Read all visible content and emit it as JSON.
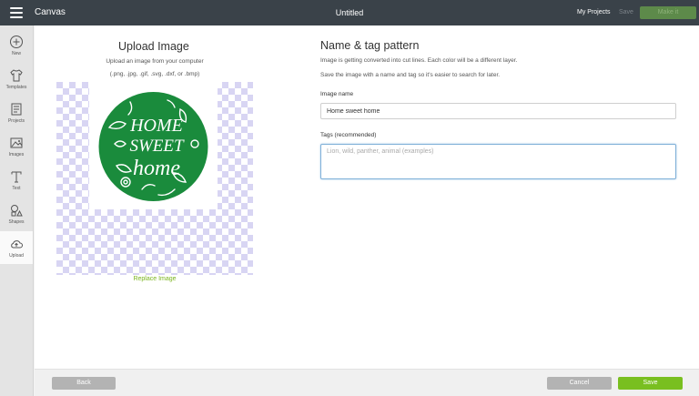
{
  "topbar": {
    "app_title": "Canvas",
    "doc_title": "Untitled",
    "my_projects": "My Projects",
    "save": "Save",
    "make_it": "Make it"
  },
  "sidebar": {
    "items": [
      {
        "label": "New",
        "icon": "plus-circle-icon"
      },
      {
        "label": "Templates",
        "icon": "tshirt-icon"
      },
      {
        "label": "Projects",
        "icon": "projects-icon"
      },
      {
        "label": "Images",
        "icon": "image-icon"
      },
      {
        "label": "Text",
        "icon": "text-icon"
      },
      {
        "label": "Shapes",
        "icon": "shapes-icon"
      },
      {
        "label": "Upload",
        "icon": "cloud-upload-icon",
        "active": true
      }
    ]
  },
  "upload": {
    "title": "Upload Image",
    "subtitle": "Upload an image from your computer",
    "file_types": "(.png, .jpg, .gif, .svg, .dxf, or .bmp)",
    "replace_link": "Replace Image",
    "preview_text": [
      "HOME",
      "SWEET",
      "home"
    ]
  },
  "form": {
    "title": "Name & tag pattern",
    "desc1": "Image is getting converted into cut lines. Each color will be a different layer.",
    "desc2": "Save the image with a name and tag so it's easier to search for later.",
    "name_label": "Image name",
    "name_value": "Home sweet home",
    "tags_label": "Tags (recommended)",
    "tags_placeholder": "Lion, wild, panther, animal (examples)"
  },
  "footer": {
    "back": "Back",
    "cancel": "Cancel",
    "save": "Save"
  },
  "colors": {
    "topbar": "#3a4249",
    "accent_green": "#79bf20",
    "preview_green": "#1a8b3c"
  }
}
